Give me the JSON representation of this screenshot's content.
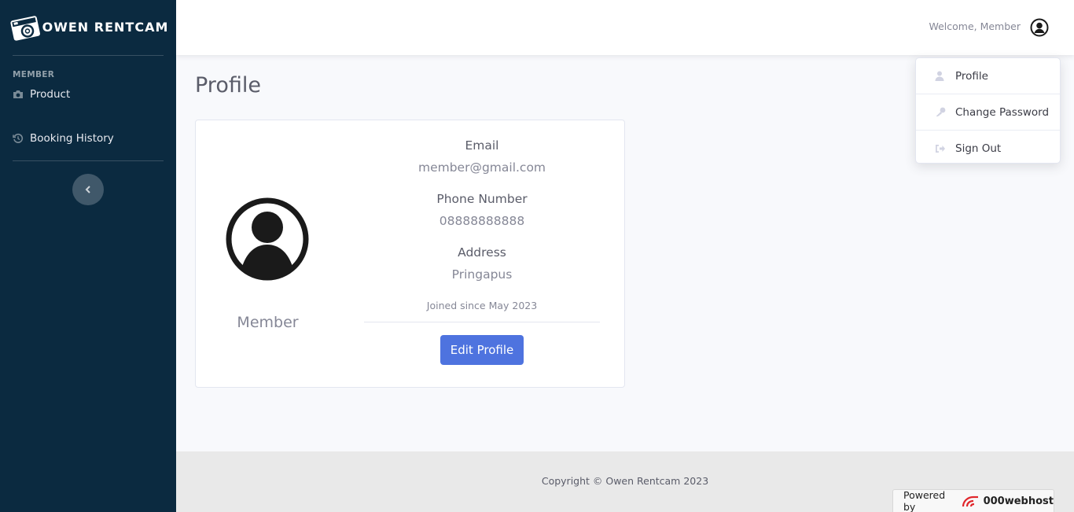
{
  "sidebar": {
    "brand": "OWEN RENTCAM",
    "heading": "MEMBER",
    "items": [
      {
        "label": "Product",
        "icon": "camera-icon"
      },
      {
        "label": "Booking History",
        "icon": "history-icon"
      }
    ],
    "toggle_icon": "chevron-left-icon"
  },
  "topbar": {
    "welcome": "Welcome, Member",
    "user_icon": "user-circle-icon"
  },
  "dropdown": {
    "items": [
      {
        "label": "Profile",
        "icon": "user-icon"
      },
      {
        "label": "Change Password",
        "icon": "key-icon"
      },
      {
        "label": "Sign Out",
        "icon": "sign-out-icon"
      }
    ]
  },
  "main": {
    "title": "Profile",
    "card": {
      "name": "Member",
      "email_label": "Email",
      "email": "member@gmail.com",
      "phone_label": "Phone Number",
      "phone": "08888888888",
      "address_label": "Address",
      "address": "Pringapus",
      "joined": "Joined since May 2023",
      "edit_button": "Edit Profile"
    }
  },
  "footer": {
    "copyright": "Copyright © Owen Rentcam 2023",
    "powered_by": "Powered by",
    "host": "000webhost"
  },
  "colors": {
    "sidebar_bg": "#0b2a40",
    "primary": "#4e73df",
    "page_bg": "#f8f9fc",
    "footer_bg": "#e9e9e9"
  }
}
